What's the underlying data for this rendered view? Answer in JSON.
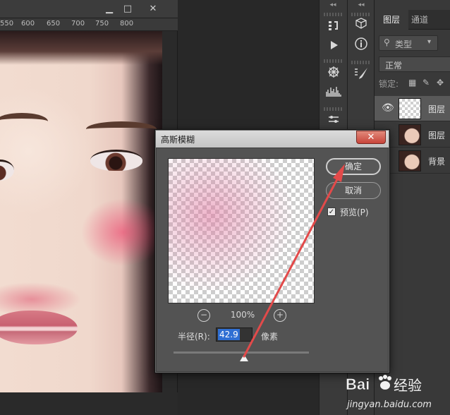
{
  "document": {
    "ruler_labels": [
      "550",
      "600",
      "650",
      "700",
      "750",
      "800"
    ],
    "window_buttons": {
      "minimize": "▁",
      "maximize": "□",
      "close": "✕"
    }
  },
  "toolbar_strip": {
    "collapse_glyph": "◂◂",
    "tools": [
      "history-icon",
      "play-icon",
      "brush-settings-icon",
      "histogram-icon",
      "adjust-icon"
    ]
  },
  "toolbar_strip2": {
    "collapse_glyph": "◂◂",
    "tools": [
      "3d-cube-icon",
      "info-icon",
      "brush-icon"
    ]
  },
  "layers_panel": {
    "tabs": [
      "图层",
      "通道"
    ],
    "filter_placeholder": "类型",
    "blend_mode": "正常",
    "lock_label": "锁定:",
    "layers": [
      {
        "name": "图层",
        "thumb": "transparent",
        "selected": true,
        "visible": true
      },
      {
        "name": "图层",
        "thumb": "photo",
        "selected": false,
        "visible": false
      },
      {
        "name": "背景",
        "thumb": "photo",
        "selected": false,
        "visible": false
      }
    ]
  },
  "dialog": {
    "title": "高斯模糊",
    "close_glyph": "✕",
    "ok_label": "确定",
    "cancel_label": "取消",
    "preview_label": "预览(P)",
    "preview_checked": true,
    "zoom_out": "−",
    "zoom_in": "+",
    "zoom_level": "100%",
    "radius_label": "半径(R):",
    "radius_value": "42.9",
    "radius_unit": "像素",
    "accent": "#2f6fd3"
  },
  "watermark": {
    "brand": "Bai 经验",
    "url": "jingyan.baidu.com"
  },
  "annotation": {
    "color": "#e24a4a"
  }
}
